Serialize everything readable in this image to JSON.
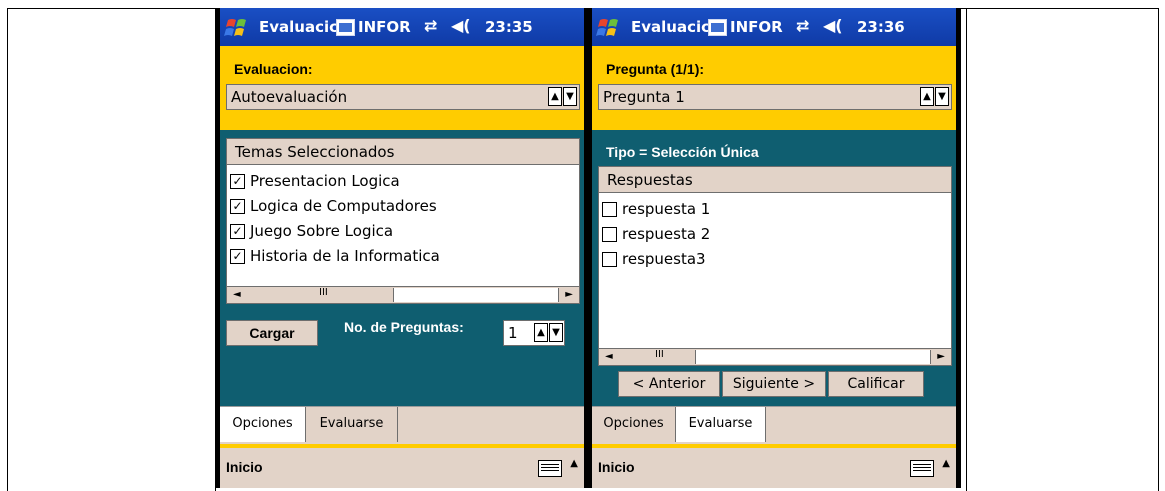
{
  "left": {
    "title": "Evaluacic",
    "info": "INFOR",
    "time": "23:35",
    "panel_label": "Evaluacion:",
    "combo_value": "Autoevaluación",
    "list_header": "Temas Seleccionados",
    "items": [
      {
        "label": "Presentacion Logica",
        "check": "✓"
      },
      {
        "label": "Logica de Computadores",
        "check": "✓"
      },
      {
        "label": "Juego Sobre Logica",
        "check": "✓"
      },
      {
        "label": "Historia de la Informatica",
        "check": "✓"
      }
    ],
    "load_button": "Cargar",
    "num_label": "No. de Preguntas:",
    "num_value": "1",
    "tabs": [
      "Opciones",
      "Evaluarse"
    ],
    "active_tab": "Opciones",
    "start": "Inicio"
  },
  "right": {
    "title": "Evaluacic",
    "info": "INFOR",
    "time": "23:36",
    "panel_label": "Pregunta (1/1):",
    "combo_value": "Pregunta 1",
    "type_label": "Tipo = Selección Única",
    "list_header": "Respuestas",
    "items": [
      {
        "label": "respuesta 1",
        "check": ""
      },
      {
        "label": "respuesta 2",
        "check": ""
      },
      {
        "label": "respuesta3",
        "check": ""
      }
    ],
    "buttons": {
      "prev": "< Anterior",
      "next": "Siguiente >",
      "grade": "Calificar"
    },
    "tabs": [
      "Opciones",
      "Evaluarse"
    ],
    "active_tab": "Evaluarse",
    "start": "Inicio"
  },
  "glyphs": {
    "up": "▲",
    "down": "▼",
    "left": "◄",
    "right": "►",
    "grip": "III",
    "sync": "⇄",
    "volume": "◀("
  },
  "colors": {
    "titlebar": "#0f3aa6",
    "panel": "#ffcc00",
    "body": "#0f5e70",
    "chrome": "#e2d3c8"
  }
}
